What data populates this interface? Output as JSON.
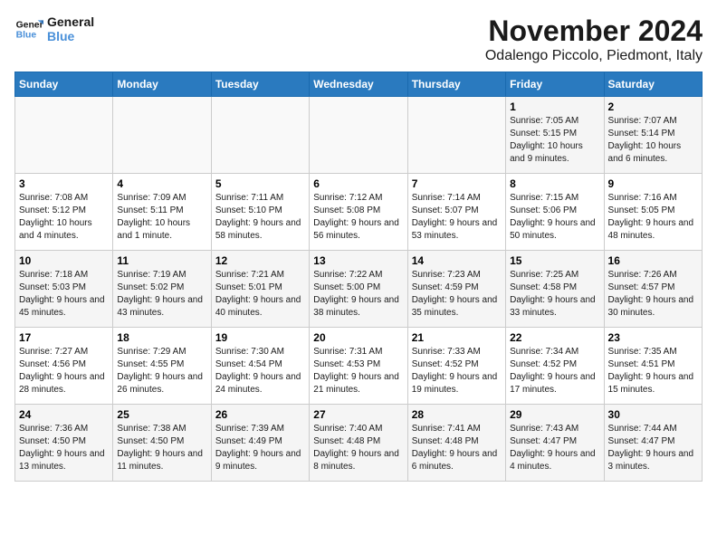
{
  "logo": {
    "line1": "General",
    "line2": "Blue"
  },
  "header": {
    "month": "November 2024",
    "location": "Odalengo Piccolo, Piedmont, Italy"
  },
  "weekdays": [
    "Sunday",
    "Monday",
    "Tuesday",
    "Wednesday",
    "Thursday",
    "Friday",
    "Saturday"
  ],
  "weeks": [
    [
      {
        "day": "",
        "info": ""
      },
      {
        "day": "",
        "info": ""
      },
      {
        "day": "",
        "info": ""
      },
      {
        "day": "",
        "info": ""
      },
      {
        "day": "",
        "info": ""
      },
      {
        "day": "1",
        "info": "Sunrise: 7:05 AM\nSunset: 5:15 PM\nDaylight: 10 hours and 9 minutes."
      },
      {
        "day": "2",
        "info": "Sunrise: 7:07 AM\nSunset: 5:14 PM\nDaylight: 10 hours and 6 minutes."
      }
    ],
    [
      {
        "day": "3",
        "info": "Sunrise: 7:08 AM\nSunset: 5:12 PM\nDaylight: 10 hours and 4 minutes."
      },
      {
        "day": "4",
        "info": "Sunrise: 7:09 AM\nSunset: 5:11 PM\nDaylight: 10 hours and 1 minute."
      },
      {
        "day": "5",
        "info": "Sunrise: 7:11 AM\nSunset: 5:10 PM\nDaylight: 9 hours and 58 minutes."
      },
      {
        "day": "6",
        "info": "Sunrise: 7:12 AM\nSunset: 5:08 PM\nDaylight: 9 hours and 56 minutes."
      },
      {
        "day": "7",
        "info": "Sunrise: 7:14 AM\nSunset: 5:07 PM\nDaylight: 9 hours and 53 minutes."
      },
      {
        "day": "8",
        "info": "Sunrise: 7:15 AM\nSunset: 5:06 PM\nDaylight: 9 hours and 50 minutes."
      },
      {
        "day": "9",
        "info": "Sunrise: 7:16 AM\nSunset: 5:05 PM\nDaylight: 9 hours and 48 minutes."
      }
    ],
    [
      {
        "day": "10",
        "info": "Sunrise: 7:18 AM\nSunset: 5:03 PM\nDaylight: 9 hours and 45 minutes."
      },
      {
        "day": "11",
        "info": "Sunrise: 7:19 AM\nSunset: 5:02 PM\nDaylight: 9 hours and 43 minutes."
      },
      {
        "day": "12",
        "info": "Sunrise: 7:21 AM\nSunset: 5:01 PM\nDaylight: 9 hours and 40 minutes."
      },
      {
        "day": "13",
        "info": "Sunrise: 7:22 AM\nSunset: 5:00 PM\nDaylight: 9 hours and 38 minutes."
      },
      {
        "day": "14",
        "info": "Sunrise: 7:23 AM\nSunset: 4:59 PM\nDaylight: 9 hours and 35 minutes."
      },
      {
        "day": "15",
        "info": "Sunrise: 7:25 AM\nSunset: 4:58 PM\nDaylight: 9 hours and 33 minutes."
      },
      {
        "day": "16",
        "info": "Sunrise: 7:26 AM\nSunset: 4:57 PM\nDaylight: 9 hours and 30 minutes."
      }
    ],
    [
      {
        "day": "17",
        "info": "Sunrise: 7:27 AM\nSunset: 4:56 PM\nDaylight: 9 hours and 28 minutes."
      },
      {
        "day": "18",
        "info": "Sunrise: 7:29 AM\nSunset: 4:55 PM\nDaylight: 9 hours and 26 minutes."
      },
      {
        "day": "19",
        "info": "Sunrise: 7:30 AM\nSunset: 4:54 PM\nDaylight: 9 hours and 24 minutes."
      },
      {
        "day": "20",
        "info": "Sunrise: 7:31 AM\nSunset: 4:53 PM\nDaylight: 9 hours and 21 minutes."
      },
      {
        "day": "21",
        "info": "Sunrise: 7:33 AM\nSunset: 4:52 PM\nDaylight: 9 hours and 19 minutes."
      },
      {
        "day": "22",
        "info": "Sunrise: 7:34 AM\nSunset: 4:52 PM\nDaylight: 9 hours and 17 minutes."
      },
      {
        "day": "23",
        "info": "Sunrise: 7:35 AM\nSunset: 4:51 PM\nDaylight: 9 hours and 15 minutes."
      }
    ],
    [
      {
        "day": "24",
        "info": "Sunrise: 7:36 AM\nSunset: 4:50 PM\nDaylight: 9 hours and 13 minutes."
      },
      {
        "day": "25",
        "info": "Sunrise: 7:38 AM\nSunset: 4:50 PM\nDaylight: 9 hours and 11 minutes."
      },
      {
        "day": "26",
        "info": "Sunrise: 7:39 AM\nSunset: 4:49 PM\nDaylight: 9 hours and 9 minutes."
      },
      {
        "day": "27",
        "info": "Sunrise: 7:40 AM\nSunset: 4:48 PM\nDaylight: 9 hours and 8 minutes."
      },
      {
        "day": "28",
        "info": "Sunrise: 7:41 AM\nSunset: 4:48 PM\nDaylight: 9 hours and 6 minutes."
      },
      {
        "day": "29",
        "info": "Sunrise: 7:43 AM\nSunset: 4:47 PM\nDaylight: 9 hours and 4 minutes."
      },
      {
        "day": "30",
        "info": "Sunrise: 7:44 AM\nSunset: 4:47 PM\nDaylight: 9 hours and 3 minutes."
      }
    ]
  ]
}
